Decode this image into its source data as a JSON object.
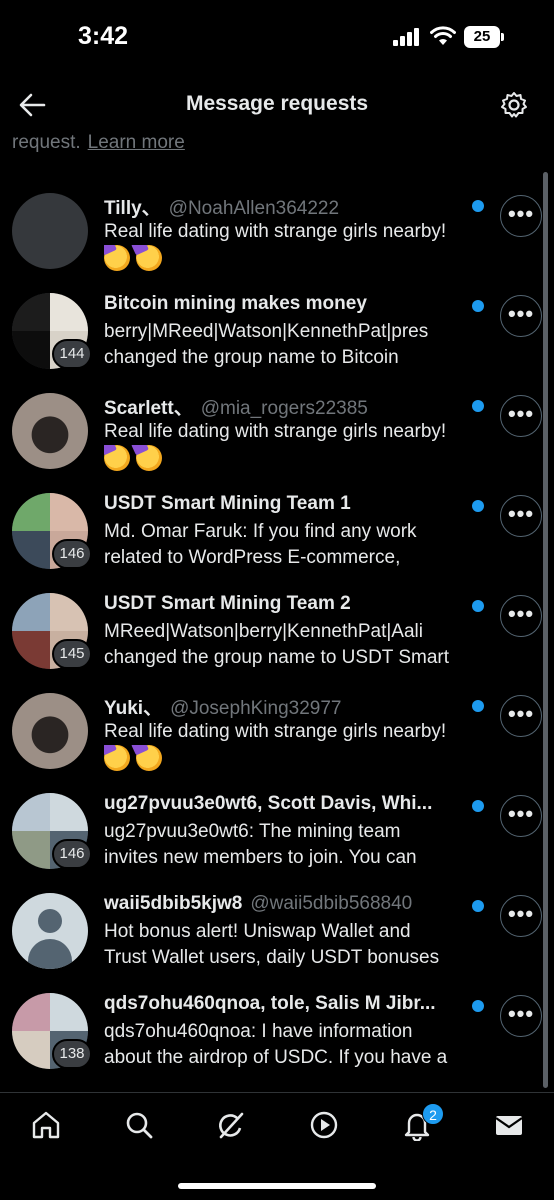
{
  "status_bar": {
    "time": "3:42",
    "battery": "25"
  },
  "header": {
    "title": "Message requests"
  },
  "notice": {
    "text": "request.",
    "link": "Learn more"
  },
  "conversations": [
    {
      "name": "Tilly、",
      "handle": "@NoahAllen364222",
      "preview": [
        "Real life dating with strange girls nearby!"
      ],
      "emoji_line": true,
      "member_count": ""
    },
    {
      "name": "Bitcoin mining makes money",
      "handle": "",
      "preview": [
        "berry|MReed|Watson|KennethPat|pres",
        "changed the group name to Bitcoin"
      ],
      "emoji_line": false,
      "member_count": "144"
    },
    {
      "name": "Scarlett、",
      "handle": "@mia_rogers22385",
      "preview": [
        "Real life dating with strange girls nearby!"
      ],
      "emoji_line": true,
      "member_count": ""
    },
    {
      "name": "USDT Smart Mining Team 1",
      "handle": "",
      "preview": [
        "Md. Omar Faruk: If you find any work",
        "related to WordPress E-commerce,"
      ],
      "emoji_line": false,
      "member_count": "146"
    },
    {
      "name": "USDT Smart Mining Team 2",
      "handle": "",
      "preview": [
        "MReed|Watson|berry|KennethPat|Aali",
        "changed the group name to USDT Smart"
      ],
      "emoji_line": false,
      "member_count": "145"
    },
    {
      "name": "Yuki、",
      "handle": "@JosephKing32977",
      "preview": [
        "Real life dating with strange girls nearby!"
      ],
      "emoji_line": true,
      "member_count": ""
    },
    {
      "name": "ug27pvuu3e0wt6, Scott Davis, Whi...",
      "handle": "",
      "preview": [
        "ug27pvuu3e0wt6: The mining team",
        "invites new members to join. You can"
      ],
      "emoji_line": false,
      "member_count": "146"
    },
    {
      "name": "waii5dbib5kjw8",
      "handle": "@waii5dbib568840",
      "preview": [
        "Hot bonus alert! Uniswap Wallet and",
        "Trust Wallet users, daily USDT bonuses"
      ],
      "emoji_line": false,
      "member_count": ""
    },
    {
      "name": "qds7ohu460qnoa, tole, Salis M Jibr...",
      "handle": "",
      "preview": [
        "qds7ohu460qnoa: I have information",
        "about the airdrop of USDC. If you have a"
      ],
      "emoji_line": false,
      "member_count": "138"
    }
  ],
  "more_label": "•••",
  "bottom_nav": {
    "items": [
      "home-icon",
      "search-icon",
      "grok-icon",
      "video-icon",
      "notifications-icon",
      "messages-icon"
    ],
    "notification_count": "2"
  },
  "colors": {
    "accent": "#1d9bf0",
    "background": "#000000",
    "secondary_text": "#71767b"
  }
}
